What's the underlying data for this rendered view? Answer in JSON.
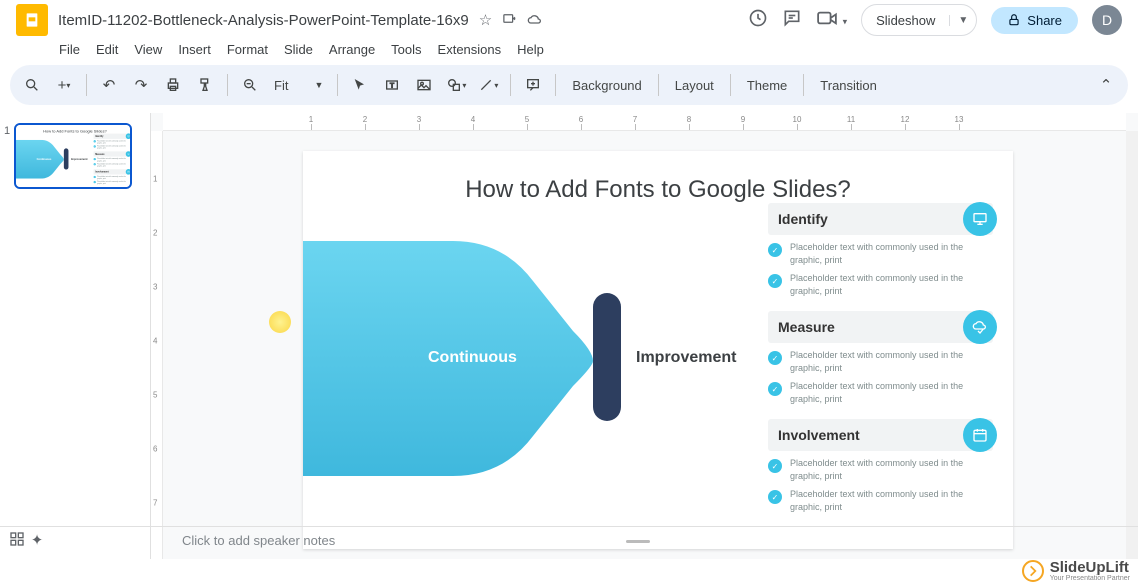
{
  "header": {
    "doc_title": "ItemID-11202-Bottleneck-Analysis-PowerPoint-Template-16x9",
    "star_icon": "☆",
    "move_icon": "⇥",
    "cloud_icon": "☁",
    "history_icon": "⟲",
    "comment_icon": "💬",
    "present_icon": "📹",
    "slideshow_label": "Slideshow",
    "share_label": "Share",
    "avatar_letter": "D"
  },
  "menu": [
    "File",
    "Edit",
    "View",
    "Insert",
    "Format",
    "Slide",
    "Arrange",
    "Tools",
    "Extensions",
    "Help"
  ],
  "toolbar": {
    "zoom_label": "Fit",
    "btns": {
      "background": "Background",
      "layout": "Layout",
      "theme": "Theme",
      "transition": "Transition"
    }
  },
  "filmstrip": {
    "slide_number": "1"
  },
  "ruler_h": [
    1,
    2,
    3,
    4,
    5,
    6,
    7,
    8,
    9,
    10,
    11,
    12,
    13
  ],
  "ruler_v": [
    1,
    2,
    3,
    4,
    5,
    6,
    7
  ],
  "slide": {
    "title": "How to Add Fonts to Google Slides?",
    "flow_left": "Continuous",
    "flow_right": "Improvement",
    "sections": [
      {
        "title": "Identify",
        "icon": "monitor",
        "bullets": [
          "Placeholder text with commonly used in the graphic, print",
          "Placeholder text with commonly used in the graphic, print"
        ]
      },
      {
        "title": "Measure",
        "icon": "cloud-check",
        "bullets": [
          "Placeholder text with commonly used in the graphic, print",
          "Placeholder text with commonly used in the graphic, print"
        ]
      },
      {
        "title": "Involvement",
        "icon": "calendar",
        "bullets": [
          "Placeholder text with commonly used in the graphic, print",
          "Placeholder text with commonly used in the graphic, print"
        ]
      }
    ]
  },
  "notes": {
    "placeholder": "Click to add speaker notes"
  },
  "watermark": {
    "brand": "SlideUpLift",
    "tagline": "Your Presentation Partner"
  }
}
